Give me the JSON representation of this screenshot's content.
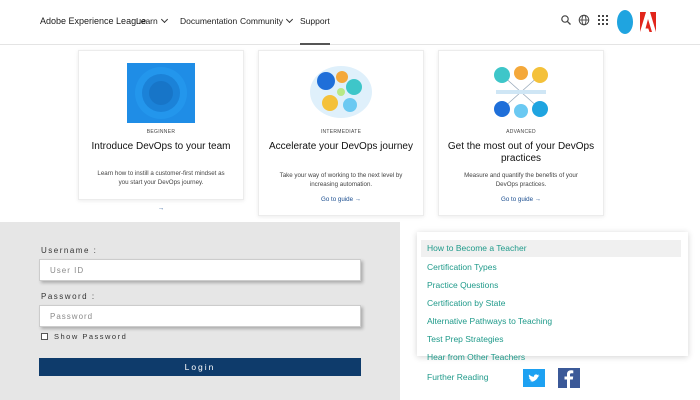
{
  "header": {
    "brand": "Adobe Experience League",
    "nav": [
      {
        "label": "Learn",
        "has_menu": true
      },
      {
        "label": "Documentation",
        "has_menu": false
      },
      {
        "label": "Community",
        "has_menu": true
      },
      {
        "label": "Support",
        "has_menu": false,
        "active": true
      }
    ],
    "icons": [
      "search-icon",
      "globe-icon",
      "apps-grid-icon",
      "avatar",
      "adobe-logo"
    ]
  },
  "cards": [
    {
      "level": "BEGINNER",
      "title": "Introduce DevOps to your team",
      "description": "Learn how to instill a customer-first mindset as you start your DevOps journey.",
      "link": "→"
    },
    {
      "level": "INTERMEDIATE",
      "title": "Accelerate your DevOps journey",
      "description": "Take your way of working to the next level by increasing automation.",
      "link": "Go to guide →"
    },
    {
      "level": "ADVANCED",
      "title": "Get the most out of your DevOps practices",
      "description": "Measure and quantify the benefits of your DevOps practices.",
      "link": "Go to guide →"
    }
  ],
  "login": {
    "username_label": "Username :",
    "username_placeholder": "User ID",
    "password_label": "Password :",
    "password_placeholder": "Password",
    "show_password": "Show Password",
    "login_button": "Login"
  },
  "links": {
    "items": [
      {
        "label": "How to Become a Teacher",
        "active": true
      },
      {
        "label": "Certification Types"
      },
      {
        "label": "Practice Questions"
      },
      {
        "label": "Certification by State"
      },
      {
        "label": "Alternative Pathways to Teaching"
      },
      {
        "label": "Test Prep Strategies"
      },
      {
        "label": "Hear from Other Teachers"
      }
    ],
    "further_reading": "Further Reading"
  },
  "colors": {
    "accent_link": "#1f9a8a",
    "login_button": "#0e3b6b",
    "twitter": "#1da1f2",
    "facebook": "#3b5998",
    "adobe_red": "#e1251b"
  }
}
